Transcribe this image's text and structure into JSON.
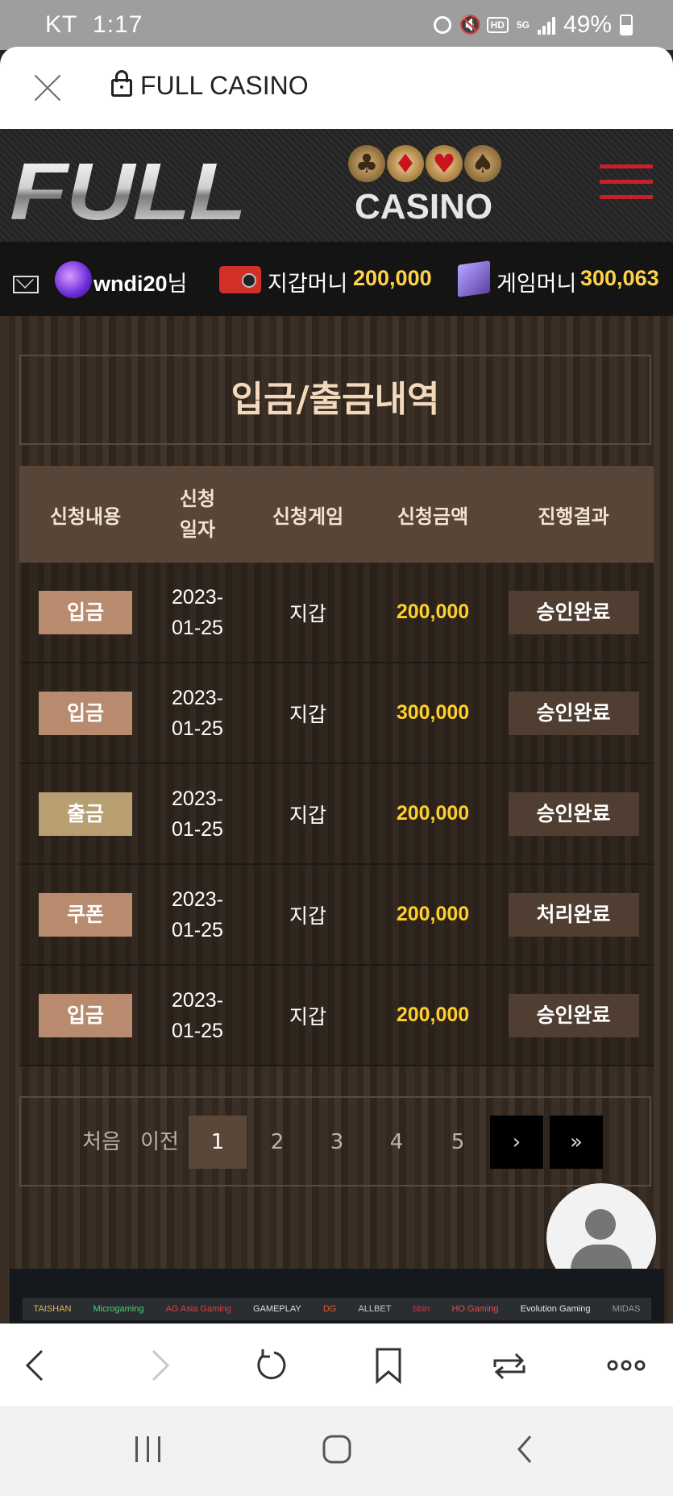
{
  "status_bar": {
    "carrier": "KT",
    "time": "1:17",
    "hd": "HD",
    "network": "5G",
    "battery": "49%"
  },
  "browser": {
    "title": "FULL CASINO"
  },
  "site": {
    "logo_main": "FULL",
    "logo_sub": "CASINO",
    "suits": [
      "♣",
      "♦",
      "♥",
      "♠"
    ]
  },
  "user": {
    "name": "wndi20",
    "suffix": "님",
    "wallet_label": "지갑머니",
    "wallet_value": "200,000",
    "game_label": "게임머니",
    "game_value": "300,063"
  },
  "page_title": "입금/출금내역",
  "table": {
    "headers": {
      "type": "신청내용",
      "date_line1": "신청",
      "date_line2": "일자",
      "game": "신청게임",
      "amount": "신청금액",
      "result": "진행결과"
    },
    "rows": [
      {
        "type": "입금",
        "type_color": "#b98b6e",
        "date_line1": "2023-",
        "date_line2": "01-25",
        "game": "지갑",
        "amount": "200,000",
        "result": "승인완료"
      },
      {
        "type": "입금",
        "type_color": "#b98b6e",
        "date_line1": "2023-",
        "date_line2": "01-25",
        "game": "지갑",
        "amount": "300,000",
        "result": "승인완료"
      },
      {
        "type": "출금",
        "type_color": "#b79f72",
        "date_line1": "2023-",
        "date_line2": "01-25",
        "game": "지갑",
        "amount": "200,000",
        "result": "승인완료"
      },
      {
        "type": "쿠폰",
        "type_color": "#b98b6e",
        "date_line1": "2023-",
        "date_line2": "01-25",
        "game": "지갑",
        "amount": "200,000",
        "result": "처리완료"
      },
      {
        "type": "입금",
        "type_color": "#b98b6e",
        "date_line1": "2023-",
        "date_line2": "01-25",
        "game": "지갑",
        "amount": "200,000",
        "result": "승인완료"
      }
    ]
  },
  "pagination": {
    "first": "처음",
    "prev": "이전",
    "pages": [
      "1",
      "2",
      "3",
      "4",
      "5"
    ],
    "current": "1",
    "next": "›",
    "last": "»"
  },
  "providers": [
    "TAISHAN",
    "Microgaming",
    "AG Asia Gaming",
    "GAMEPLAY",
    "DG",
    "ALLBET",
    "bbin",
    "HO Gaming",
    "Evolution Gaming",
    "MIDAS"
  ],
  "colors": {
    "accent_yellow": "#ffd02a",
    "hamburger_red": "#c8202a",
    "header_bg": "#574538"
  }
}
